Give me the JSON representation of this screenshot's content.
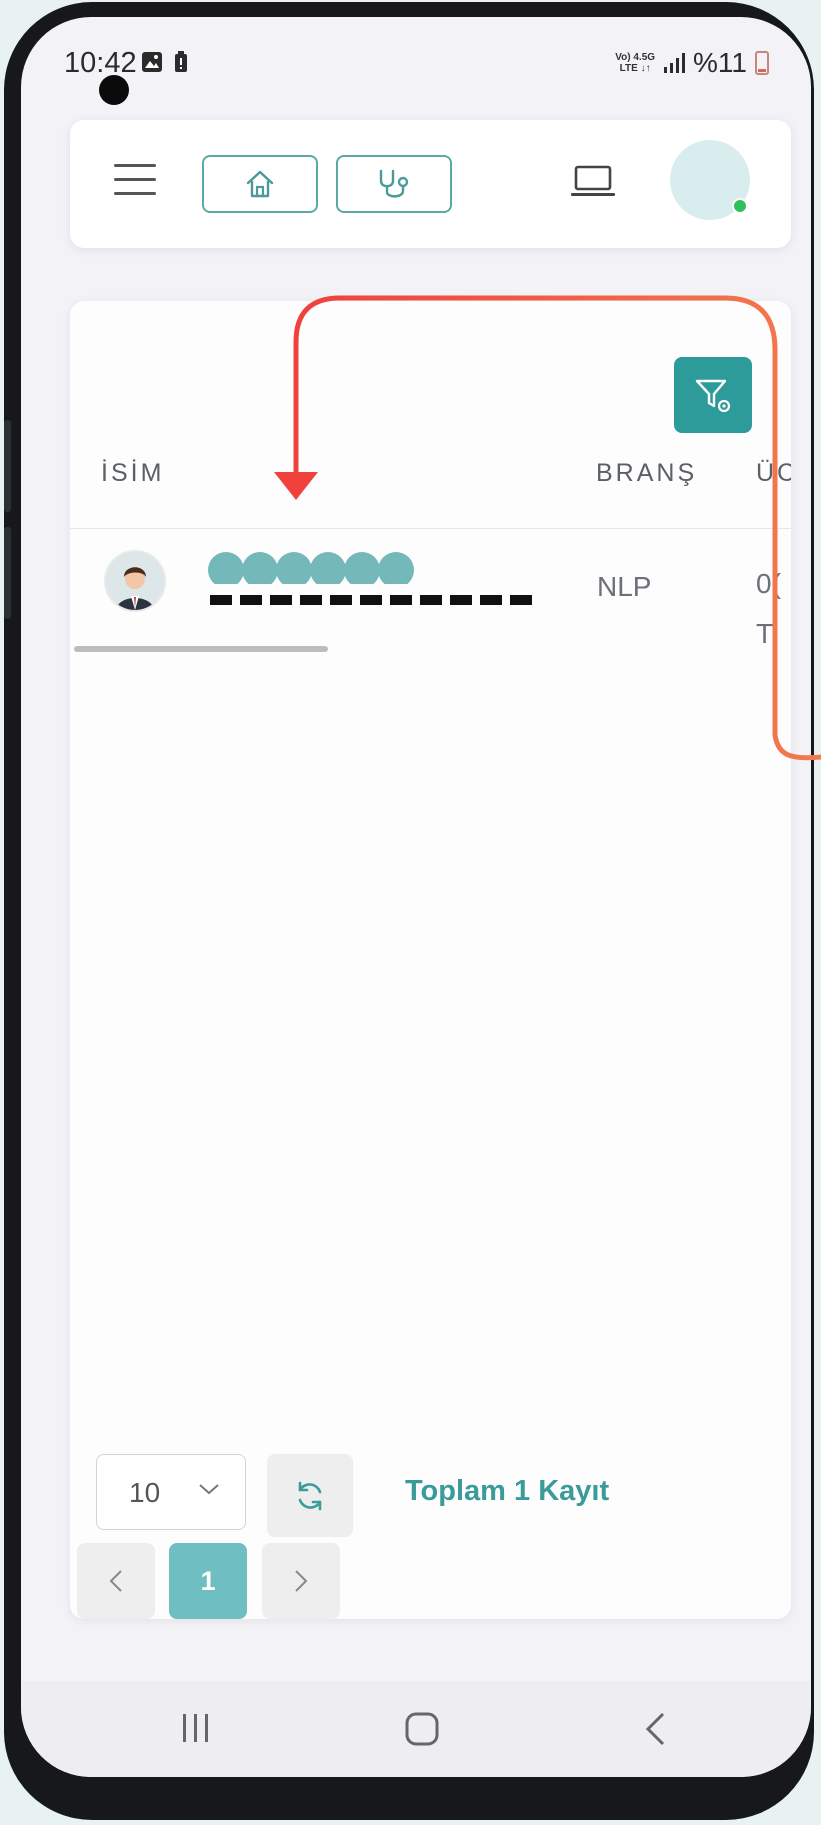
{
  "status_bar": {
    "time": "10:42",
    "network_line1": "Vo) 4.5G",
    "network_line2": "LTE ↓↑",
    "battery_percent": "%11"
  },
  "header": {
    "menu_icon": "hamburger-icon",
    "home_icon": "home-icon",
    "doctor_icon": "stethoscope-icon",
    "laptop_icon": "laptop-icon",
    "user_status": "online",
    "accent_color": "#5aa9a6"
  },
  "table": {
    "filter_icon": "filter-settings-icon",
    "columns": {
      "name": "İSİM",
      "branch": "BRANŞ",
      "fee": "ÜC"
    },
    "rows": [
      {
        "name": "",
        "email": "",
        "branch": "NLP",
        "fee_line1": "0(",
        "fee_line2": "T"
      }
    ]
  },
  "pagination": {
    "per_page": "10",
    "total": "Toplam 1 Kayıt",
    "current_page": "1",
    "prev": "‹",
    "next": "›"
  },
  "colors": {
    "primary": "#2e9b9b",
    "page_active": "#6fbec1",
    "annotation_red": "#f0413d",
    "annotation_orange": "#f27a4e"
  }
}
